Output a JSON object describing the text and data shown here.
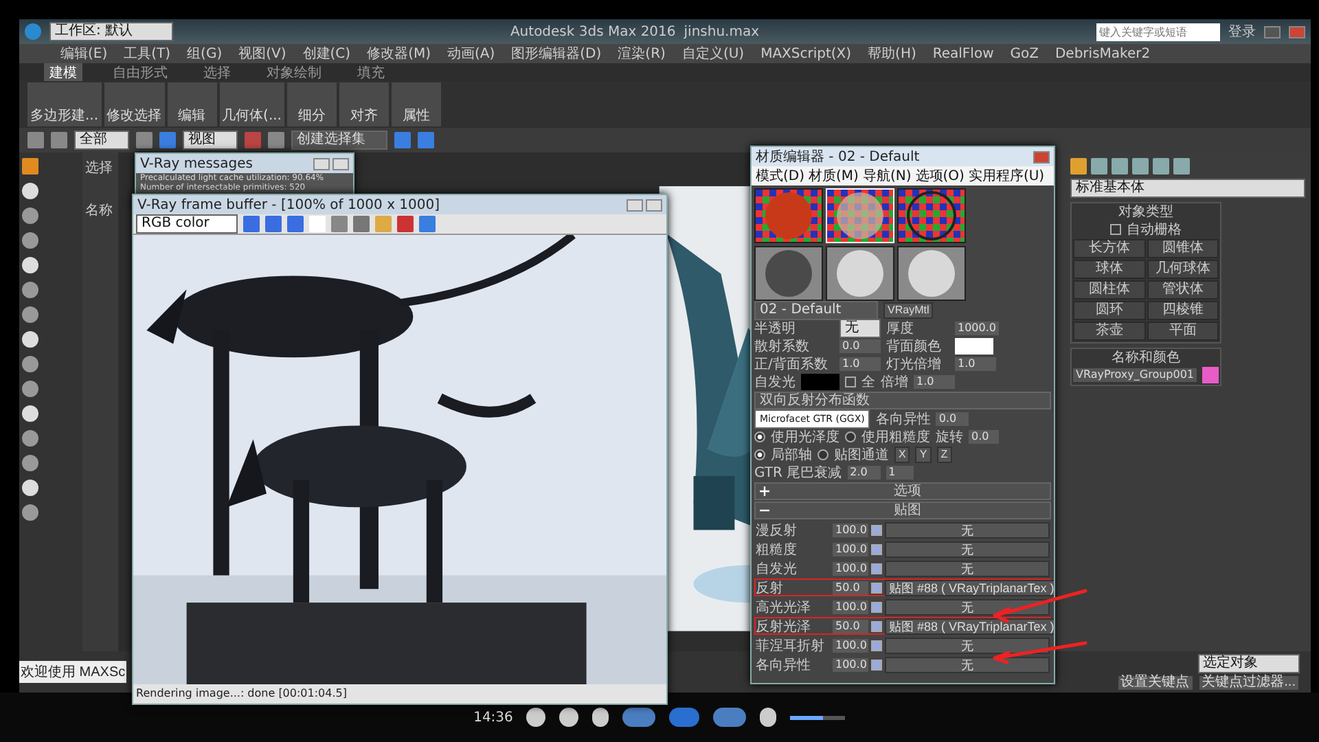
{
  "app": {
    "title": "Autodesk 3ds Max 2016",
    "file": "jinshu.max",
    "workspace": "工作区: 默认",
    "search": {
      "placeholder": "键入关键字或短语"
    },
    "user": "登录"
  },
  "menus": [
    "编辑(E)",
    "工具(T)",
    "组(G)",
    "视图(V)",
    "创建(C)",
    "修改器(M)",
    "动画(A)",
    "图形编辑器(D)",
    "渲染(R)",
    "自定义(U)",
    "MAXScript(X)",
    "帮助(H)",
    "RealFlow",
    "GoZ",
    "DebrisMaker2"
  ],
  "ribbon": {
    "tabs": [
      {
        "label": "建模",
        "selected": true
      },
      {
        "label": "自由形式",
        "selected": false
      },
      {
        "label": "选择",
        "selected": false
      },
      {
        "label": "对象绘制",
        "selected": false
      },
      {
        "label": "填充",
        "selected": false
      }
    ],
    "buttons": [
      "多边形建...",
      "修改选择",
      "编辑",
      "几何体(...",
      "细分",
      "对齐",
      "属性"
    ]
  },
  "toolbar": {
    "filter": "全部",
    "view": "视图",
    "selection_set": "创建选择集"
  },
  "left_panel": {
    "labels": [
      "选择",
      "名称"
    ]
  },
  "vray_messages": {
    "title": "V-Ray messages",
    "lines": [
      "Precalculated light cache utilization: 90.64%",
      "Number of intersectable primitives: 520"
    ]
  },
  "frame_buffer": {
    "title": "V-Ray frame buffer - [100% of 1000 x 1000]",
    "channel": "RGB color",
    "status": "Rendering image...: done [00:01:04.5]"
  },
  "material_editor": {
    "title": "材质编辑器 - 02 - Default",
    "menus": [
      "模式(D)",
      "材质(M)",
      "导航(N)",
      "选项(O)",
      "实用程序(U)"
    ],
    "slots": [
      {
        "kind": "red",
        "selected": false
      },
      {
        "kind": "glass",
        "selected": true
      },
      {
        "kind": "checker",
        "selected": false
      },
      {
        "kind": "dark",
        "selected": false
      },
      {
        "kind": "grey",
        "selected": false
      },
      {
        "kind": "grey",
        "selected": false
      }
    ],
    "material_name": "02 - Default",
    "material_type": "VRayMtl",
    "params": [
      {
        "label": "半透明",
        "kind": "dropdown",
        "value": "无",
        "label2": "厚度",
        "value2": "1000.0"
      },
      {
        "label": "散射系数",
        "kind": "number",
        "value": "0.0",
        "label2": "背面颜色"
      },
      {
        "label": "正/背面系数",
        "kind": "number",
        "value": "1.0",
        "label2": "灯光倍增",
        "value2": "1.0"
      }
    ],
    "self_illum": {
      "label": "自发光",
      "all_label": "全",
      "all_checked": false,
      "mult_label": "倍增",
      "mult": "1.0"
    },
    "brdf": {
      "title": "双向反射分布函数",
      "type": "Microfacet GTR (GGX)",
      "anisotropy_label": "各向异性",
      "anisotropy": "0.0",
      "rotation_label": "旋转",
      "rotation": "0.0",
      "radios": [
        {
          "label": "使用光泽度",
          "selected": true
        },
        {
          "label": "使用粗糙度",
          "selected": false
        }
      ],
      "axis_radios": [
        {
          "label": "局部轴",
          "selected": true
        },
        {
          "label": "贴图通道",
          "selected": false
        }
      ],
      "axes": [
        "X",
        "Y",
        "Z"
      ],
      "tail_label": "GTR 尾巴衰减",
      "tail": "2.0",
      "channel": "1"
    },
    "sections": [
      {
        "label": "选项",
        "expanded": false
      },
      {
        "label": "贴图",
        "expanded": true
      }
    ],
    "maps": [
      {
        "label": "漫反射",
        "amount": "100.0",
        "on": true,
        "map": "无",
        "highlighted": false
      },
      {
        "label": "粗糙度",
        "amount": "100.0",
        "on": true,
        "map": "无",
        "highlighted": false
      },
      {
        "label": "自发光",
        "amount": "100.0",
        "on": true,
        "map": "无",
        "highlighted": false
      },
      {
        "label": "反射",
        "amount": "50.0",
        "on": true,
        "map": "贴图 #88 ( VRayTriplanarTex )",
        "highlighted": true
      },
      {
        "label": "高光光泽",
        "amount": "100.0",
        "on": true,
        "map": "无",
        "highlighted": false
      },
      {
        "label": "反射光泽",
        "amount": "50.0",
        "on": true,
        "map": "贴图 #88 ( VRayTriplanarTex )",
        "highlighted": true
      },
      {
        "label": "菲涅耳折射",
        "amount": "100.0",
        "on": true,
        "map": "无",
        "highlighted": false
      },
      {
        "label": "各向异性",
        "amount": "100.0",
        "on": true,
        "map": "无",
        "highlighted": false
      }
    ]
  },
  "command_panel": {
    "category": "标准基本体",
    "object_type_title": "对象类型",
    "autogrid": {
      "label": "自动栅格",
      "checked": false
    },
    "objects": [
      "长方体",
      "圆锥体",
      "球体",
      "几何球体",
      "圆柱体",
      "管状体",
      "圆环",
      "四棱锥",
      "茶壶",
      "平面"
    ],
    "name_color_title": "名称和颜色",
    "object_name": "VRayProxy_Group001",
    "color": "#e85cc8"
  },
  "status": {
    "welcome": "欢迎使用 MAXSc",
    "selected": "选定对象",
    "set_key": "设置关键点",
    "key_filter": "关键点过滤器..."
  },
  "player": {
    "time": "14:36",
    "volume": {
      "level": 0.6
    }
  }
}
